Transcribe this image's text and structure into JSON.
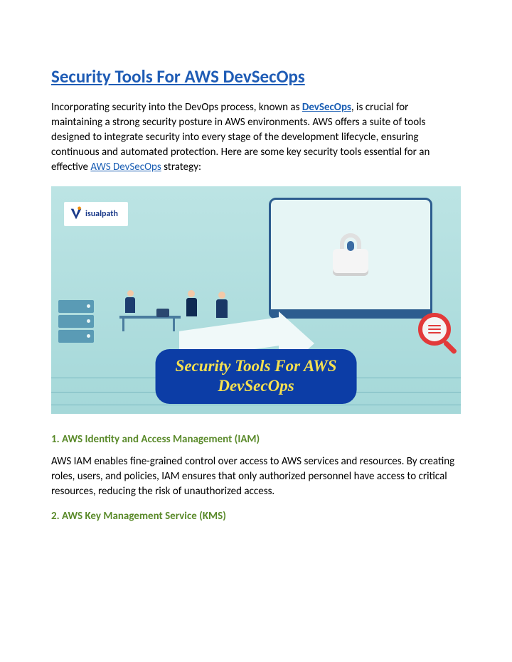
{
  "title": "Security Tools For AWS DevSecOps",
  "intro": {
    "seg1": "Incorporating security into the DevOps process, known as ",
    "link1": "DevSecOps",
    "seg2": ", is crucial for maintaining a strong security posture in AWS environments. AWS offers a suite of tools designed to integrate security into every stage of the development lifecycle, ensuring continuous and automated protection. Here are some key security tools essential for an effective ",
    "link2": "AWS DevSecOps",
    "seg3": " strategy:"
  },
  "hero": {
    "logo_name": "isualpath",
    "banner_line1": "Security Tools For AWS",
    "banner_line2": "DevSecOps"
  },
  "sections": [
    {
      "heading": "1. AWS Identity and Access Management (IAM)",
      "paragraph": "AWS IAM enables fine-grained control over access to AWS services and resources. By creating roles, users, and policies, IAM ensures that only authorized personnel have access to critical resources, reducing the risk of unauthorized access."
    },
    {
      "heading": "2. AWS Key Management Service (KMS)",
      "paragraph": ""
    }
  ]
}
